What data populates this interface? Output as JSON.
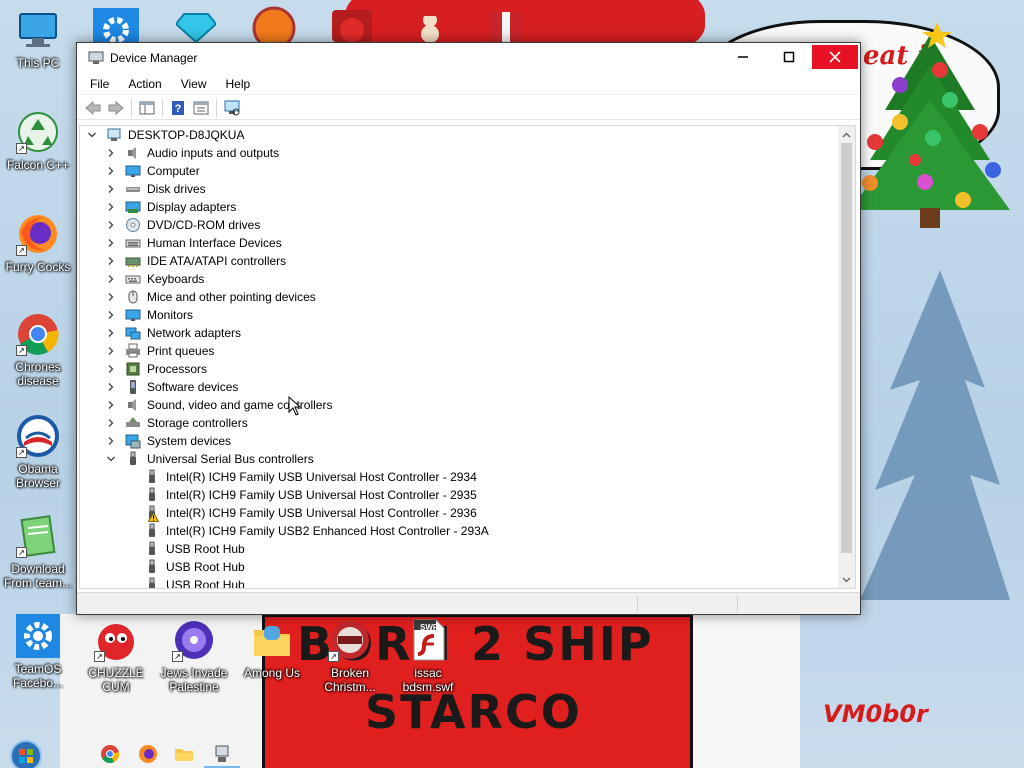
{
  "desktop": {
    "left_icons": [
      {
        "label": "This PC",
        "icon": "this-pc-icon"
      },
      {
        "label": "Falcon C++",
        "icon": "recycle-icon"
      },
      {
        "label": "Furry Cocks",
        "icon": "firefox-icon"
      },
      {
        "label": "Chrones disease",
        "icon": "chrome-icon"
      },
      {
        "label": "Obama Browser",
        "icon": "obama-logo-icon"
      },
      {
        "label": "Download From team...",
        "icon": "notebook-icon"
      },
      {
        "label": "TeamOS Facebo...",
        "icon": "gear-icon"
      }
    ],
    "bottom_icons": [
      {
        "label": "CHUZZLE CUM",
        "icon": "chuzzle-icon"
      },
      {
        "label": "Jews Invade Palestine",
        "icon": "disc-icon"
      },
      {
        "label": "Among Us",
        "icon": "folder-icon"
      },
      {
        "label": "Broken Christm...",
        "icon": "game-disc-icon"
      },
      {
        "label": "issac bdsm.swf",
        "icon": "flash-file-icon"
      }
    ],
    "swf_badge": "SWF",
    "wallpaper_text": {
      "born": "BORN 2 SHIP",
      "starco": "STARCO",
      "scrawl": "eat it",
      "vm": "VM0b0r"
    }
  },
  "window": {
    "title": "Device Manager",
    "menu": [
      "File",
      "Action",
      "View",
      "Help"
    ],
    "toolbar": [
      "back-arrow-icon",
      "forward-arrow-icon",
      "show-hide-console-tree-icon",
      "help-icon",
      "properties-icon",
      "scan-hardware-icon"
    ],
    "computer_name": "DESKTOP-D8JQKUA",
    "categories": [
      {
        "label": "Audio inputs and outputs",
        "icon": "speaker-icon",
        "expanded": false
      },
      {
        "label": "Computer",
        "icon": "monitor-icon",
        "expanded": false
      },
      {
        "label": "Disk drives",
        "icon": "disk-drive-icon",
        "expanded": false
      },
      {
        "label": "Display adapters",
        "icon": "display-adapter-icon",
        "expanded": false
      },
      {
        "label": "DVD/CD-ROM drives",
        "icon": "dvd-icon",
        "expanded": false
      },
      {
        "label": "Human Interface Devices",
        "icon": "hid-icon",
        "expanded": false
      },
      {
        "label": "IDE ATA/ATAPI controllers",
        "icon": "ide-controller-icon",
        "expanded": false
      },
      {
        "label": "Keyboards",
        "icon": "keyboard-icon",
        "expanded": false
      },
      {
        "label": "Mice and other pointing devices",
        "icon": "mouse-icon",
        "expanded": false
      },
      {
        "label": "Monitors",
        "icon": "monitor-icon",
        "expanded": false
      },
      {
        "label": "Network adapters",
        "icon": "network-adapter-icon",
        "expanded": false
      },
      {
        "label": "Print queues",
        "icon": "printer-icon",
        "expanded": false
      },
      {
        "label": "Processors",
        "icon": "processor-icon",
        "expanded": false
      },
      {
        "label": "Software devices",
        "icon": "software-device-icon",
        "expanded": false
      },
      {
        "label": "Sound, video and game controllers",
        "icon": "speaker-icon",
        "expanded": false
      },
      {
        "label": "Storage controllers",
        "icon": "storage-controller-icon",
        "expanded": false
      },
      {
        "label": "System devices",
        "icon": "system-devices-icon",
        "expanded": false
      },
      {
        "label": "Universal Serial Bus controllers",
        "icon": "usb-icon",
        "expanded": true
      }
    ],
    "usb_children": [
      {
        "label": "Intel(R) ICH9 Family USB Universal Host Controller - 2934",
        "warning": false
      },
      {
        "label": "Intel(R) ICH9 Family USB Universal Host Controller - 2935",
        "warning": false
      },
      {
        "label": "Intel(R) ICH9 Family USB Universal Host Controller - 2936",
        "warning": true
      },
      {
        "label": "Intel(R) ICH9 Family USB2 Enhanced Host Controller - 293A",
        "warning": false
      },
      {
        "label": "USB Root Hub",
        "warning": false
      },
      {
        "label": "USB Root Hub",
        "warning": false
      },
      {
        "label": "USB Root Hub",
        "warning": false
      }
    ]
  },
  "taskbar": {
    "pinned": [
      "chrome-icon",
      "firefox-icon",
      "file-explorer-icon",
      "device-manager-icon"
    ]
  },
  "colors": {
    "close_button": "#e81123",
    "wallpaper_red": "#e0201f",
    "wallpaper_sky": "#c6dcec"
  }
}
